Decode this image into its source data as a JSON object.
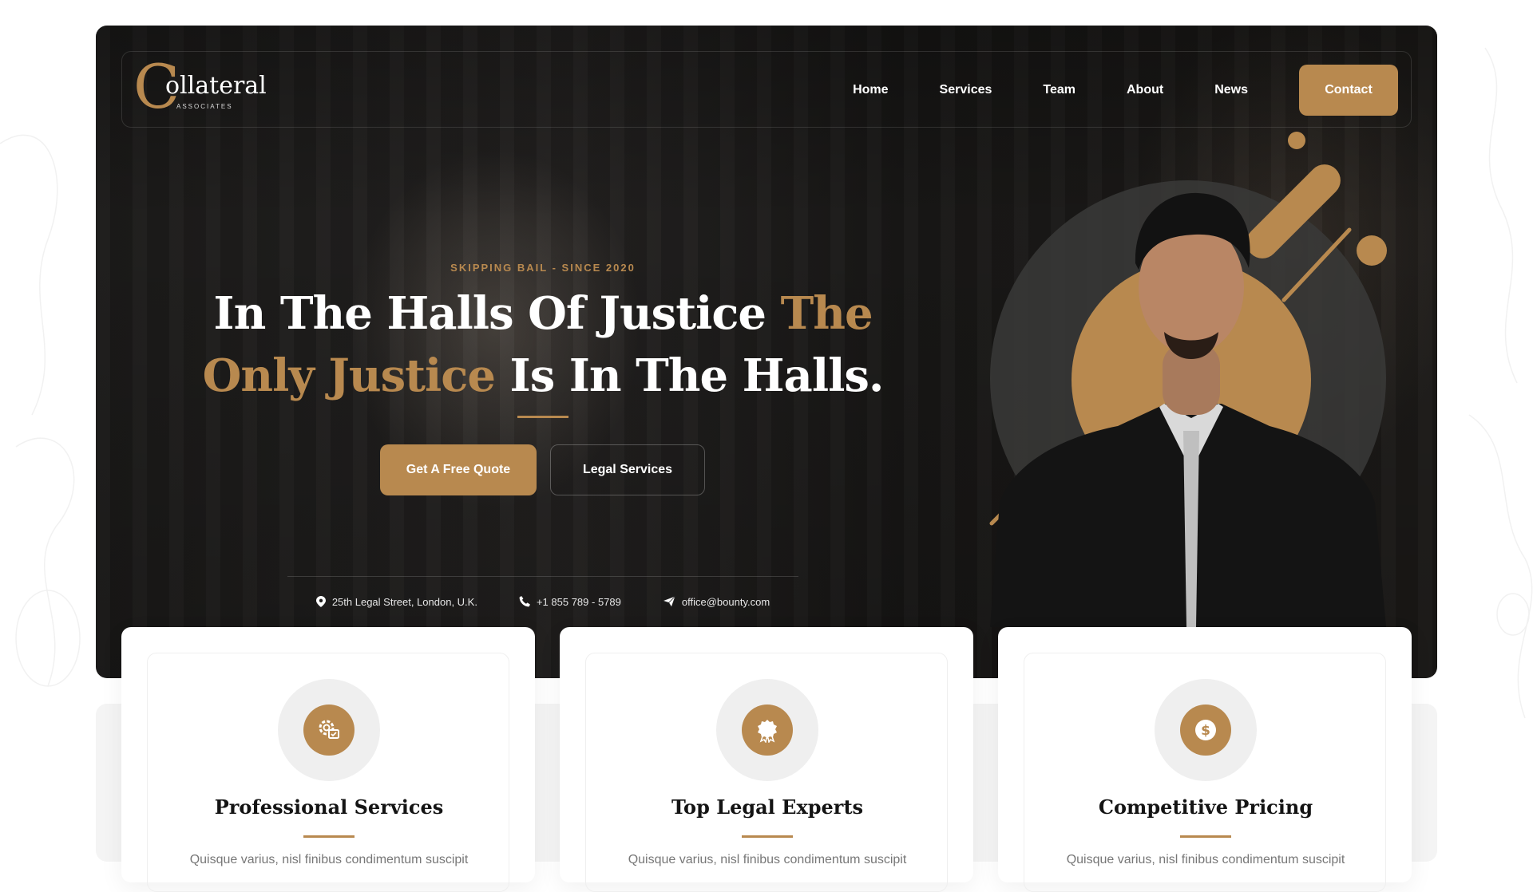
{
  "brand": {
    "logo_letter": "C",
    "logo_name": "ollateral",
    "logo_sub": "ASSOCIATES"
  },
  "nav": {
    "items": [
      {
        "label": "Home"
      },
      {
        "label": "Services"
      },
      {
        "label": "Team"
      },
      {
        "label": "About"
      },
      {
        "label": "News"
      }
    ],
    "contact_label": "Contact"
  },
  "hero": {
    "kicker": "SKIPPING BAIL - SINCE 2020",
    "headline_part1": "In The Halls Of Justice ",
    "headline_gold": "The Only Justice",
    "headline_part2": " Is In The Halls.",
    "primary_button": "Get A Free Quote",
    "secondary_button": "Legal Services"
  },
  "contact_info": {
    "address": "25th Legal Street, London, U.K.",
    "phone": "+1 855 789 - 5789",
    "email": "office@bounty.com"
  },
  "features": [
    {
      "icon": "gear-settings-icon",
      "title": "Professional Services",
      "text": "Quisque varius, nisl finibus condimentum suscipit"
    },
    {
      "icon": "award-badge-icon",
      "title": "Top Legal Experts",
      "text": "Quisque varius, nisl finibus condimentum suscipit"
    },
    {
      "icon": "dollar-coin-icon",
      "title": "Competitive Pricing",
      "text": "Quisque varius, nisl finibus condimentum suscipit"
    }
  ],
  "colors": {
    "accent": "#b8894f",
    "dark": "#1b1a19",
    "card_bg": "#ffffff"
  }
}
